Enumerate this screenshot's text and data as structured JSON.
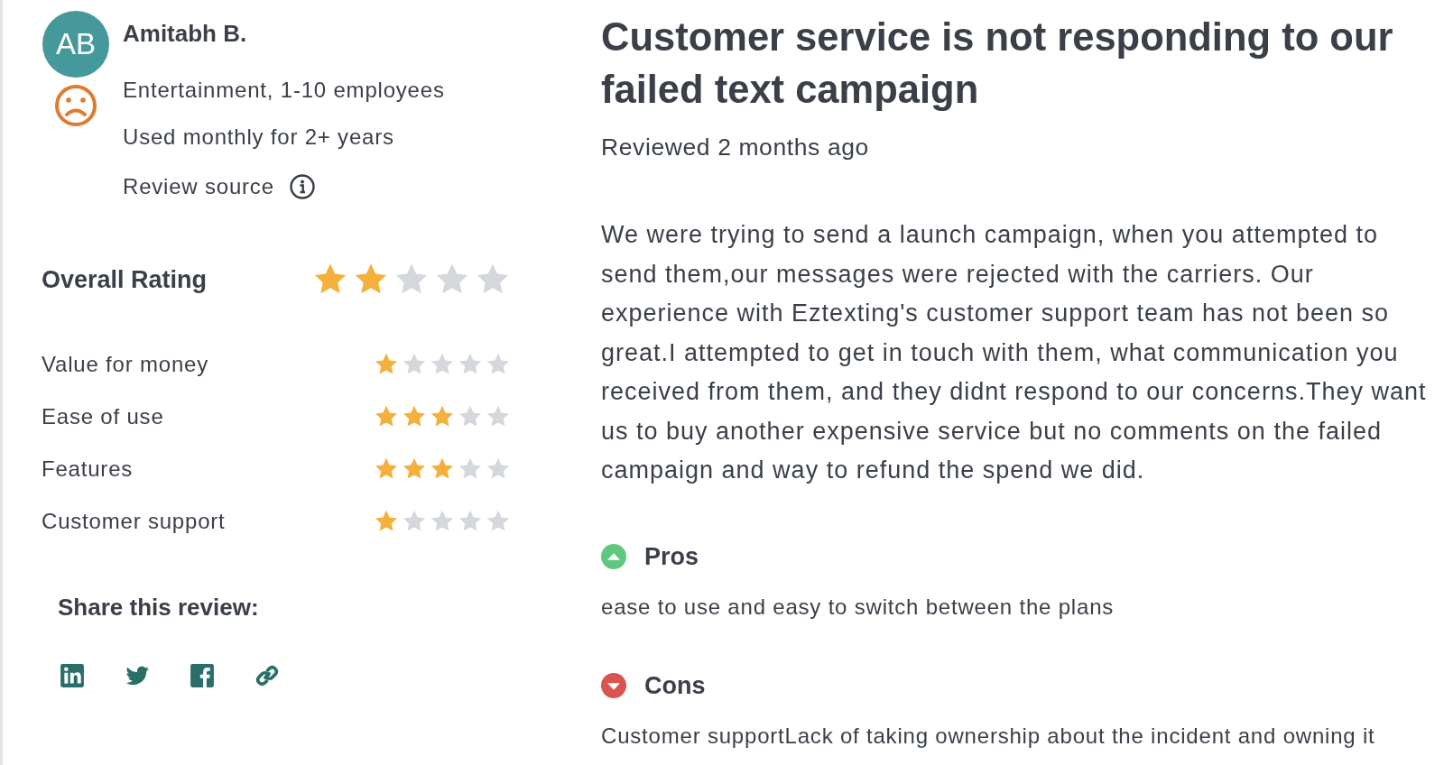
{
  "reviewer": {
    "initials": "AB",
    "name": "Amitabh B.",
    "face": {
      "kind": "sad"
    },
    "details": [
      "Entertainment, 1-10 employees",
      "Used monthly for 2+ years"
    ],
    "source_label": "Review source"
  },
  "overall_rating": {
    "label": "Overall Rating",
    "stars": 2
  },
  "category_ratings": [
    {
      "label": "Value for money",
      "stars": 1
    },
    {
      "label": "Ease of use",
      "stars": 3
    },
    {
      "label": "Features",
      "stars": 3
    },
    {
      "label": "Customer support",
      "stars": 1
    }
  ],
  "share": {
    "label": "Share this review:",
    "links": [
      {
        "kind": "linkedin"
      },
      {
        "kind": "twitter"
      },
      {
        "kind": "facebook"
      },
      {
        "kind": "link"
      }
    ]
  },
  "review": {
    "title": "Customer service is not responding to our failed text campaign",
    "date": "Reviewed 2 months ago",
    "body": "We were trying to send a launch campaign, when you attempted to send them,our messages were rejected with the carriers. Our experience with Eztexting's customer support team has not been so great.I attempted to get in touch with them, what communication you received from them, and they didnt respond to our concerns.They want us to buy another expensive service but no comments on the failed campaign and way to refund the spend we did.",
    "sections": [
      {
        "kind": "pros",
        "title": "Pros",
        "text": "ease to use and easy to switch between the plans"
      },
      {
        "kind": "cons",
        "title": "Cons",
        "text": "Customer supportLack of taking ownership about the incident and owning it"
      }
    ]
  }
}
